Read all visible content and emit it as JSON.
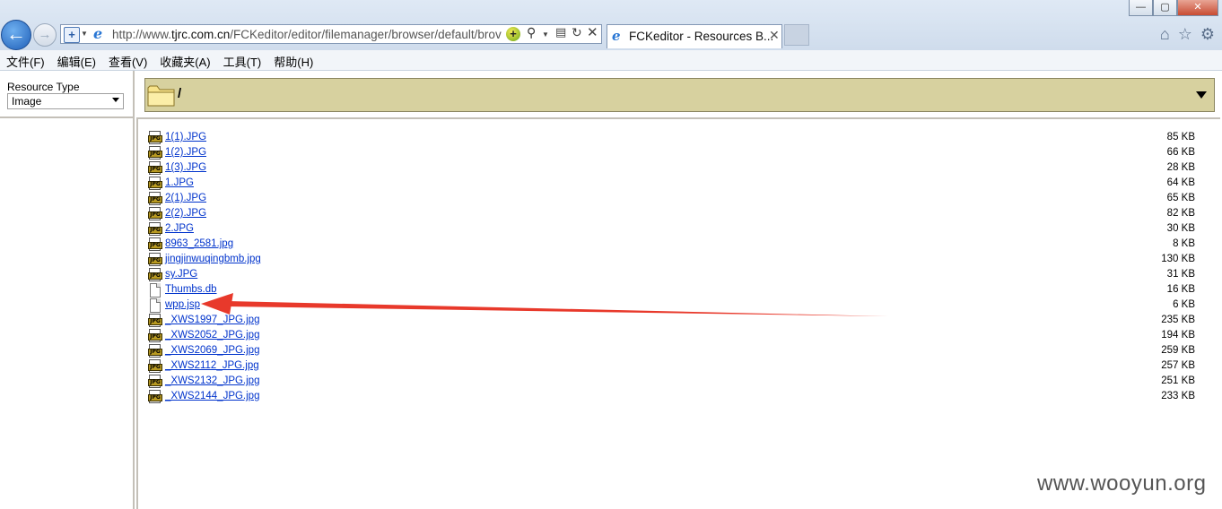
{
  "browser": {
    "address": {
      "url_prefix": "http://www.",
      "url_host": "tjrc.com.cn",
      "url_path": "/FCKeditor/editor/filemanager/browser/default/brov"
    },
    "tab": {
      "title": "FCKeditor - Resources B..."
    },
    "window_controls": {
      "minimize": "—",
      "maximize": "▢",
      "close": "✕"
    }
  },
  "menubar": [
    {
      "label": "文件(F)"
    },
    {
      "label": "编辑(E)"
    },
    {
      "label": "查看(V)"
    },
    {
      "label": "收藏夹(A)"
    },
    {
      "label": "工具(T)"
    },
    {
      "label": "帮助(H)"
    }
  ],
  "left_frame": {
    "resource_type_label": "Resource Type",
    "resource_type_value": "Image"
  },
  "folder_bar": {
    "path": "/"
  },
  "files": [
    {
      "name": "1(1).JPG",
      "size": "85 KB",
      "icon": "jpg-file-icon"
    },
    {
      "name": "1(2).JPG",
      "size": "66 KB",
      "icon": "jpg-file-icon"
    },
    {
      "name": "1(3).JPG",
      "size": "28 KB",
      "icon": "jpg-file-icon"
    },
    {
      "name": "1.JPG",
      "size": "64 KB",
      "icon": "jpg-file-icon"
    },
    {
      "name": "2(1).JPG",
      "size": "65 KB",
      "icon": "jpg-file-icon"
    },
    {
      "name": "2(2).JPG",
      "size": "82 KB",
      "icon": "jpg-file-icon"
    },
    {
      "name": "2.JPG",
      "size": "30 KB",
      "icon": "jpg-file-icon"
    },
    {
      "name": "8963_2581.jpg",
      "size": "8 KB",
      "icon": "jpg-file-icon"
    },
    {
      "name": "jingjinwuqingbmb.jpg",
      "size": "130 KB",
      "icon": "jpg-file-icon"
    },
    {
      "name": "sy.JPG",
      "size": "31 KB",
      "icon": "jpg-file-icon"
    },
    {
      "name": "Thumbs.db",
      "size": "16 KB",
      "icon": "generic-file-icon"
    },
    {
      "name": "wpp.jsp",
      "size": "6 KB",
      "icon": "generic-file-icon"
    },
    {
      "name": "_XWS1997_JPG.jpg",
      "size": "235 KB",
      "icon": "jpg-file-icon"
    },
    {
      "name": "_XWS2052_JPG.jpg",
      "size": "194 KB",
      "icon": "jpg-file-icon"
    },
    {
      "name": "_XWS2069_JPG.jpg",
      "size": "259 KB",
      "icon": "jpg-file-icon"
    },
    {
      "name": "_XWS2112_JPG.jpg",
      "size": "257 KB",
      "icon": "jpg-file-icon"
    },
    {
      "name": "_XWS2132_JPG.jpg",
      "size": "251 KB",
      "icon": "jpg-file-icon"
    },
    {
      "name": "_XWS2144_JPG.jpg",
      "size": "233 KB",
      "icon": "jpg-file-icon"
    }
  ],
  "jpg_badge_text": "JPG",
  "annotation": {
    "color": "#e8392b",
    "points_to": "wpp.jsp"
  },
  "watermark": "www.wooyun.org"
}
